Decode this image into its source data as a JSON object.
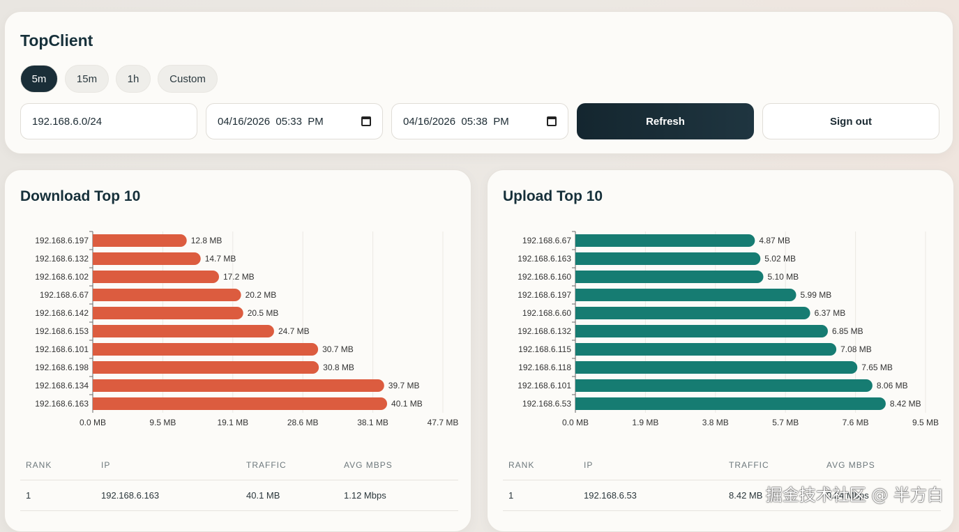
{
  "app": {
    "title": "TopClient"
  },
  "ranges": [
    {
      "label": "5m",
      "active": true
    },
    {
      "label": "15m"
    },
    {
      "label": "1h"
    },
    {
      "label": "Custom"
    }
  ],
  "filters": {
    "subnet": "192.168.6.0/24",
    "start": "04/16/2026  05:33  PM",
    "end": "04/16/2026  05:38  PM"
  },
  "buttons": {
    "refresh": "Refresh",
    "signout": "Sign out"
  },
  "download": {
    "title": "Download Top 10",
    "color": "#dc5c3f",
    "xmax": 47.7,
    "ticks": [
      "0.0 MB",
      "9.5 MB",
      "19.1 MB",
      "28.6 MB",
      "38.1 MB",
      "47.7 MB"
    ],
    "ips": [
      "192.168.6.197",
      "192.168.6.132",
      "192.168.6.102",
      "192.168.6.67",
      "192.168.6.142",
      "192.168.6.153",
      "192.168.6.101",
      "192.168.6.198",
      "192.168.6.134",
      "192.168.6.163"
    ],
    "values": [
      12.8,
      14.7,
      17.2,
      20.2,
      20.5,
      24.7,
      30.7,
      30.8,
      39.7,
      40.1
    ],
    "labels": [
      "12.8 MB",
      "14.7 MB",
      "17.2 MB",
      "20.2 MB",
      "20.5 MB",
      "24.7 MB",
      "30.7 MB",
      "30.8 MB",
      "39.7 MB",
      "40.1 MB"
    ],
    "table": {
      "headers": [
        "RANK",
        "IP",
        "TRAFFIC",
        "AVG MBPS"
      ],
      "rows": [
        [
          "1",
          "192.168.6.163",
          "40.1 MB",
          "1.12 Mbps"
        ]
      ]
    }
  },
  "upload": {
    "title": "Upload Top 10",
    "color": "#167c72",
    "xmax": 9.5,
    "ticks": [
      "0.0 MB",
      "1.9 MB",
      "3.8 MB",
      "5.7 MB",
      "7.6 MB",
      "9.5 MB"
    ],
    "ips": [
      "192.168.6.67",
      "192.168.6.163",
      "192.168.6.160",
      "192.168.6.197",
      "192.168.6.60",
      "192.168.6.132",
      "192.168.6.115",
      "192.168.6.118",
      "192.168.6.101",
      "192.168.6.53"
    ],
    "values": [
      4.87,
      5.02,
      5.1,
      5.99,
      6.37,
      6.85,
      7.08,
      7.65,
      8.06,
      8.42
    ],
    "labels": [
      "4.87 MB",
      "5.02 MB",
      "5.10 MB",
      "5.99 MB",
      "6.37 MB",
      "6.85 MB",
      "7.08 MB",
      "7.65 MB",
      "8.06 MB",
      "8.42 MB"
    ],
    "table": {
      "headers": [
        "RANK",
        "IP",
        "TRAFFIC",
        "AVG MBPS"
      ],
      "rows": [
        [
          "1",
          "192.168.6.53",
          "8.42 MB",
          "0.24 Mbps"
        ]
      ]
    }
  },
  "watermark": "掘金技术社区 @ 半方白"
}
